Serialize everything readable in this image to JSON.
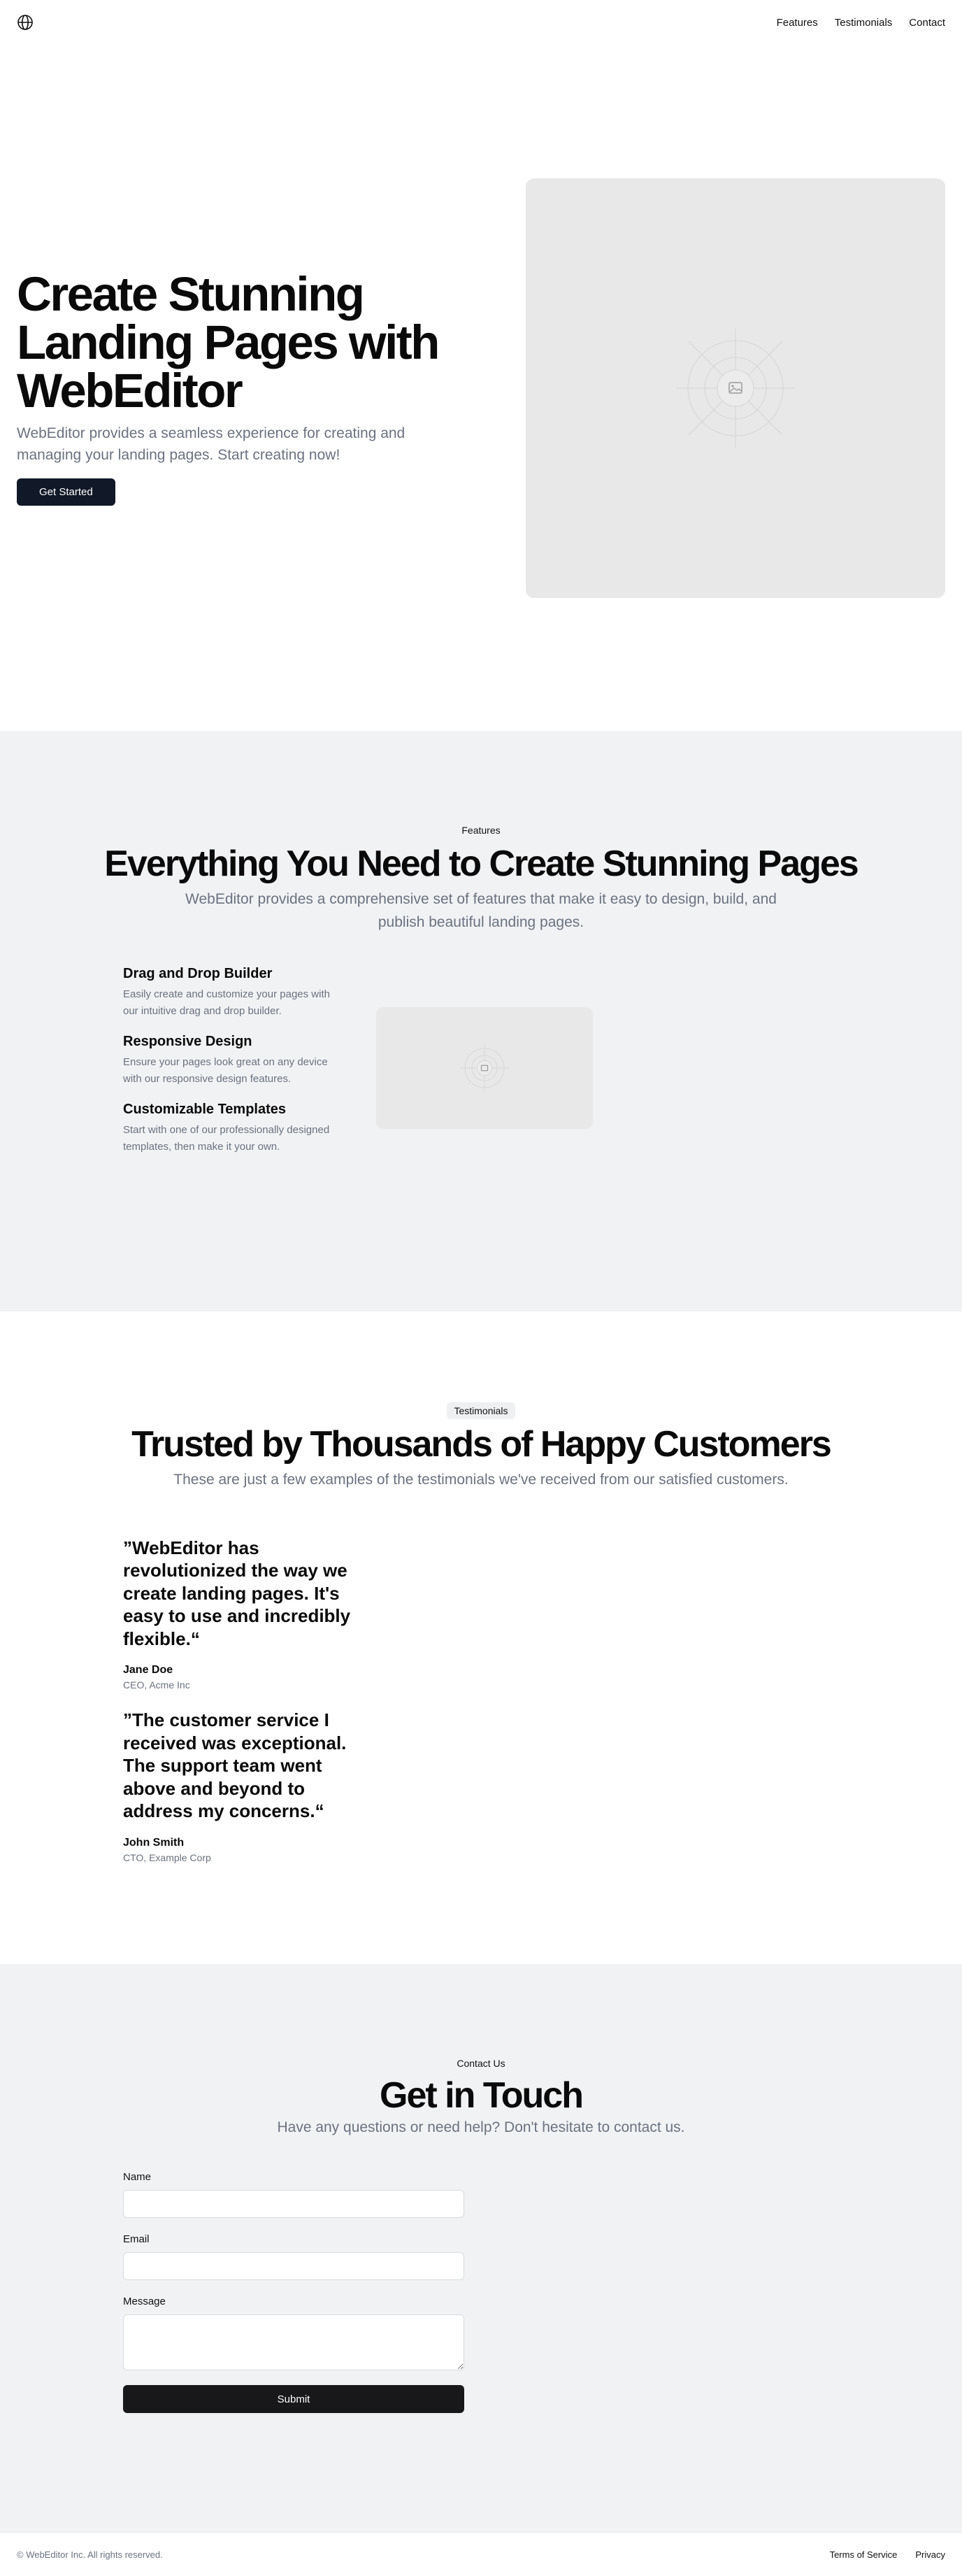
{
  "header": {
    "logo_icon": "globe-icon",
    "nav": [
      {
        "label": "Features"
      },
      {
        "label": "Testimonials"
      },
      {
        "label": "Contact"
      }
    ]
  },
  "hero": {
    "title": "Create Stunning Landing Pages with WebEditor",
    "subtitle": "WebEditor provides a seamless experience for creating and managing your landing pages. Start creating now!",
    "cta_label": "Get Started",
    "image_icon": "image-placeholder-icon"
  },
  "features": {
    "badge": "Features",
    "title": "Everything You Need to Create Stunning Pages",
    "subtitle": "WebEditor provides a comprehensive set of features that make it easy to design, build, and publish beautiful landing pages.",
    "items": [
      {
        "title": "Drag and Drop Builder",
        "text": "Easily create and customize your pages with our intuitive drag and drop builder."
      },
      {
        "title": "Responsive Design",
        "text": "Ensure your pages look great on any device with our responsive design features."
      },
      {
        "title": "Customizable Templates",
        "text": "Start with one of our professionally designed templates, then make it your own."
      }
    ]
  },
  "testimonials": {
    "badge": "Testimonials",
    "title": "Trusted by Thousands of Happy Customers",
    "subtitle": "These are just a few examples of the testimonials we've received from our satisfied customers.",
    "items": [
      {
        "quote": "”WebEditor has revolutionized the way we create landing pages. It's easy to use and incredibly flexible.“",
        "name": "Jane Doe",
        "role": "CEO, Acme Inc"
      },
      {
        "quote": "”The customer service I received was exceptional. The support team went above and beyond to address my concerns.“",
        "name": "John Smith",
        "role": "CTO, Example Corp"
      }
    ]
  },
  "contact": {
    "badge": "Contact Us",
    "title": "Get in Touch",
    "subtitle": "Have any questions or need help? Don't hesitate to contact us.",
    "name_label": "Name",
    "email_label": "Email",
    "message_label": "Message",
    "submit_label": "Submit"
  },
  "footer": {
    "copyright": "© WebEditor Inc. All rights reserved.",
    "links": [
      {
        "label": "Terms of Service"
      },
      {
        "label": "Privacy"
      }
    ]
  }
}
